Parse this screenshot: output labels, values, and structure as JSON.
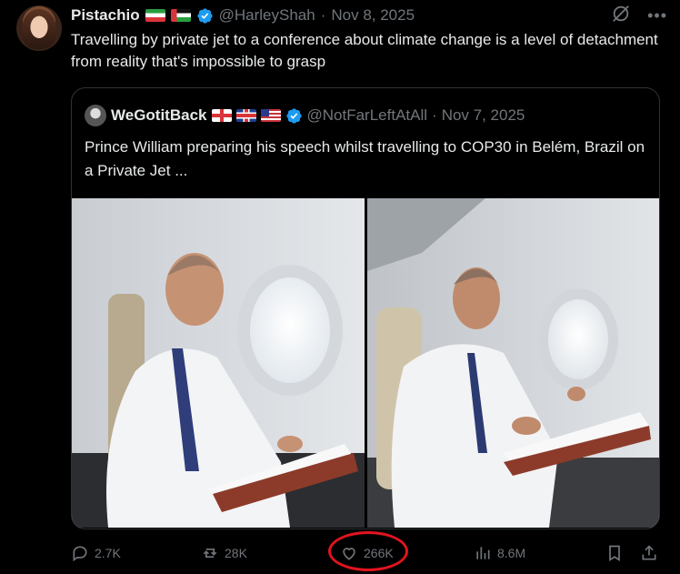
{
  "tweet": {
    "author_name": "Pistachio",
    "handle": "@HarleyShah",
    "separator": "·",
    "date": "Nov 8, 2025",
    "text": "Travelling by private jet to a conference about climate change is a level of detachment from reality that's impossible to grasp"
  },
  "quoted": {
    "author_name": "WeGotitBack",
    "handle": "@NotFarLeftAtAll",
    "separator": "·",
    "date": "Nov 7, 2025",
    "text": "Prince William preparing his speech whilst travelling to COP30 in Belém, Brazil on a Private Jet ..."
  },
  "actions": {
    "replies": "2.7K",
    "reposts": "28K",
    "likes": "266K",
    "views": "8.6M"
  },
  "colors": {
    "background": "#000000",
    "text": "#e7e9ea",
    "muted": "#71767b",
    "verified": "#1d9bf0",
    "highlight_circle": "#e0141e"
  },
  "icons": [
    "verified-badge-icon",
    "grok-icon",
    "more-icon",
    "reply-icon",
    "repost-icon",
    "like-icon",
    "views-icon",
    "bookmark-icon",
    "share-icon"
  ]
}
